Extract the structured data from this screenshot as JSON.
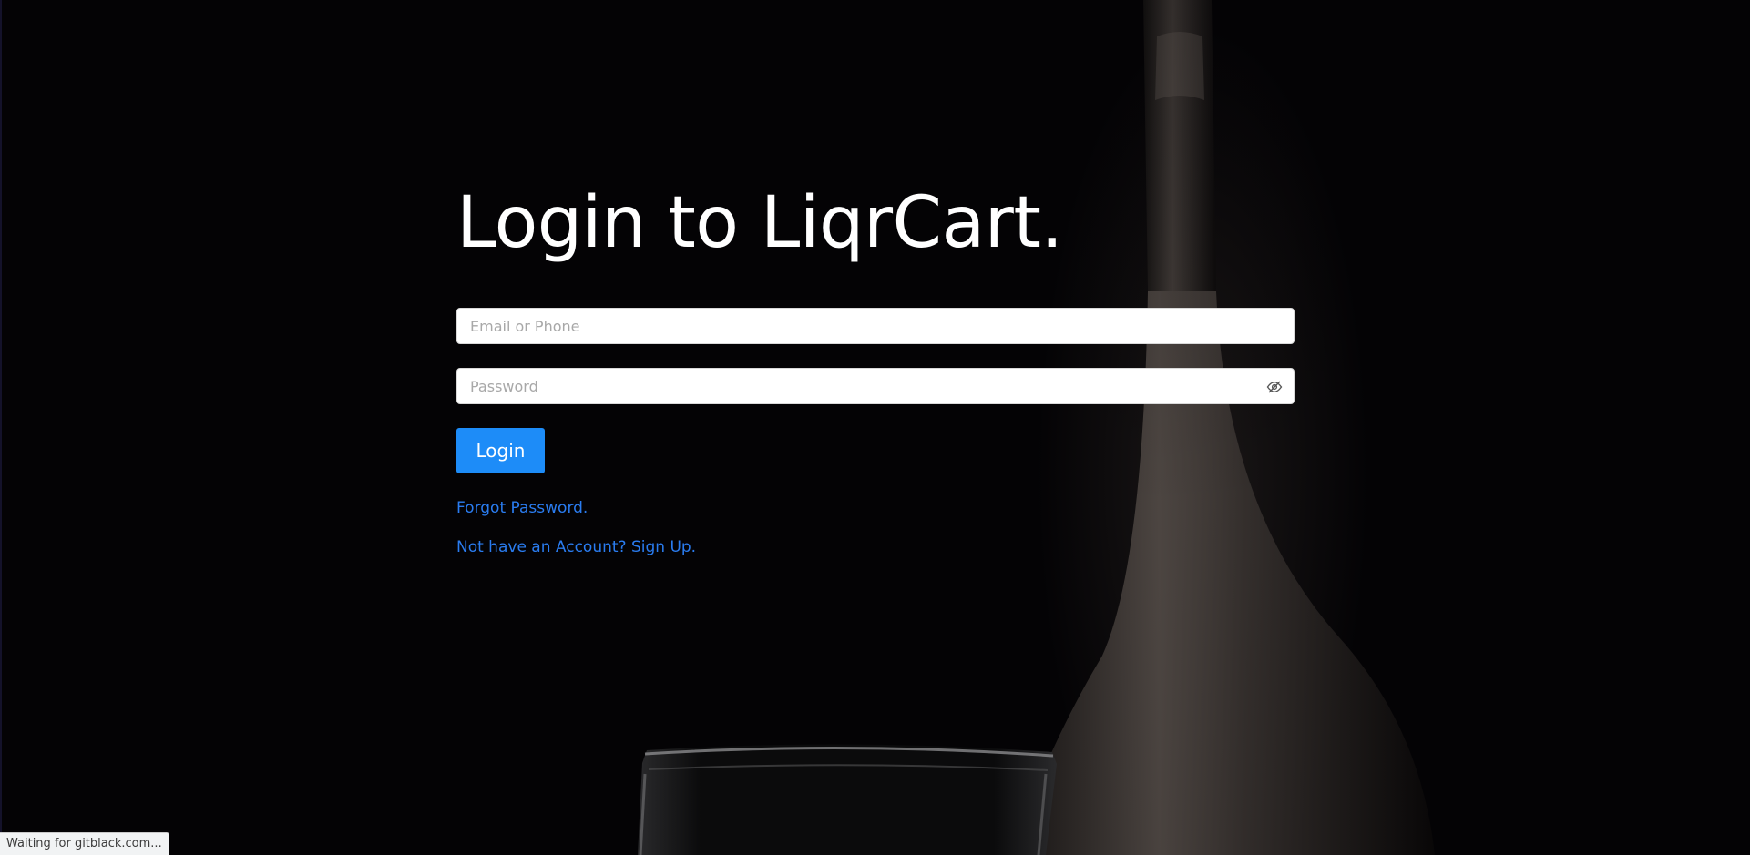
{
  "page": {
    "title": "Login to LiqrCart."
  },
  "form": {
    "email_placeholder": "Email or Phone",
    "password_placeholder": "Password",
    "password_toggle_icon": "eye-slash-icon",
    "login_label": "Login"
  },
  "links": {
    "forgot_password": "Forgot Password.",
    "sign_up": "Not have an Account? Sign Up."
  },
  "browser": {
    "status_text": "Waiting for gitblack.com..."
  },
  "colors": {
    "background": "#040305",
    "title": "#ffffff",
    "button": "#1d8cf8",
    "link": "#2a7cf0"
  }
}
